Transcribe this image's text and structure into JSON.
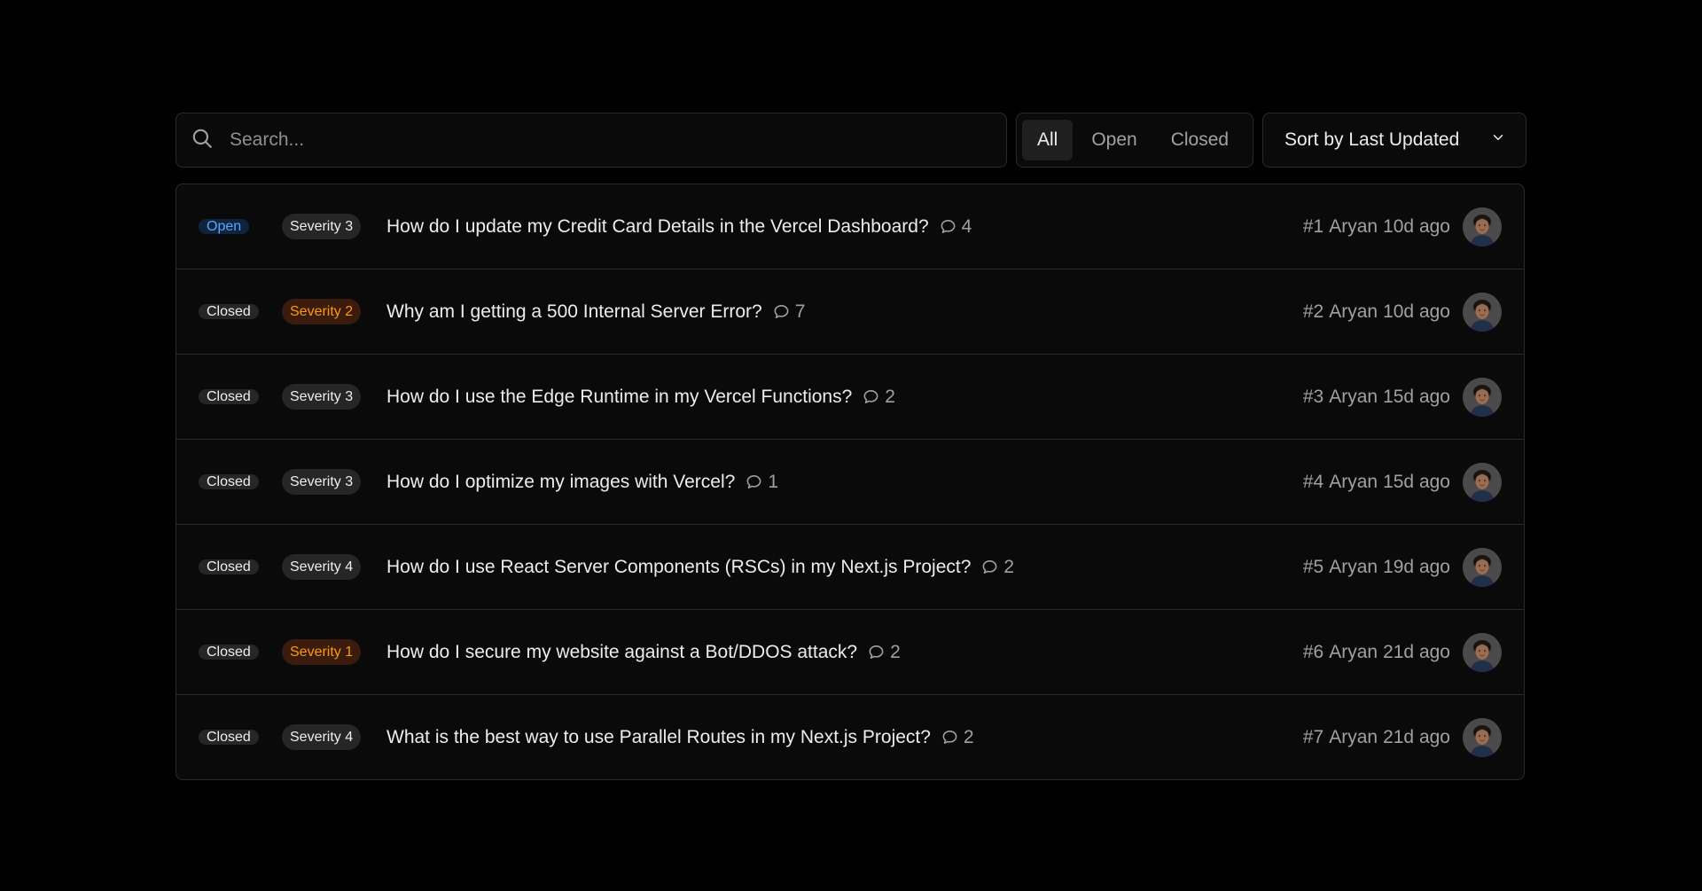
{
  "search": {
    "placeholder": "Search..."
  },
  "filters": [
    {
      "label": "All",
      "active": true
    },
    {
      "label": "Open",
      "active": false
    },
    {
      "label": "Closed",
      "active": false
    }
  ],
  "sort": {
    "label": "Sort by Last Updated"
  },
  "colors": {
    "background": "#000000",
    "panel": "#0a0a0a",
    "border": "#2a2a2a",
    "open_badge_text": "#52a8ff",
    "high_severity_text": "#ff990a"
  },
  "issues": [
    {
      "status": "Open",
      "severity": "Severity 3",
      "title": "How do I update my Credit Card Details in the Vercel Dashboard?",
      "comments": "4",
      "number": "#1",
      "author": "Aryan",
      "updated": "10d ago"
    },
    {
      "status": "Closed",
      "severity": "Severity 2",
      "title": "Why am I getting a 500 Internal Server Error?",
      "comments": "7",
      "number": "#2",
      "author": "Aryan",
      "updated": "10d ago"
    },
    {
      "status": "Closed",
      "severity": "Severity 3",
      "title": "How do I use the Edge Runtime in my Vercel Functions?",
      "comments": "2",
      "number": "#3",
      "author": "Aryan",
      "updated": "15d ago"
    },
    {
      "status": "Closed",
      "severity": "Severity 3",
      "title": "How do I optimize my images with Vercel?",
      "comments": "1",
      "number": "#4",
      "author": "Aryan",
      "updated": "15d ago"
    },
    {
      "status": "Closed",
      "severity": "Severity 4",
      "title": "How do I use React Server Components (RSCs) in my Next.js Project?",
      "comments": "2",
      "number": "#5",
      "author": "Aryan",
      "updated": "19d ago"
    },
    {
      "status": "Closed",
      "severity": "Severity 1",
      "title": "How do I secure my website against a Bot/DDOS attack?",
      "comments": "2",
      "number": "#6",
      "author": "Aryan",
      "updated": "21d ago"
    },
    {
      "status": "Closed",
      "severity": "Severity 4",
      "title": "What is the best way to use Parallel Routes in my Next.js Project?",
      "comments": "2",
      "number": "#7",
      "author": "Aryan",
      "updated": "21d ago"
    }
  ]
}
